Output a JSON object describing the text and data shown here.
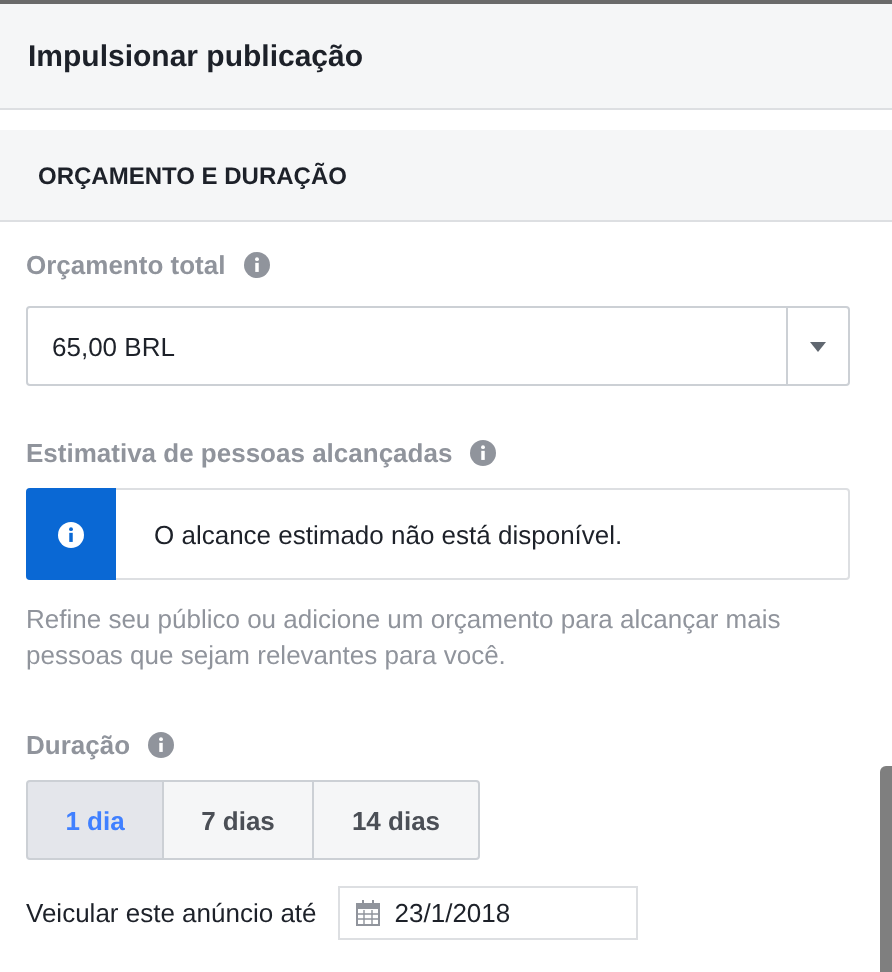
{
  "header": {
    "title": "Impulsionar publicação"
  },
  "section": {
    "title": "ORÇAMENTO E DURAÇÃO"
  },
  "budget": {
    "label": "Orçamento total",
    "value": "65,00 BRL"
  },
  "reach": {
    "label": "Estimativa de pessoas alcançadas",
    "notice": "O alcance estimado não está disponível.",
    "hint": "Refine seu público ou adicione um orçamento para alcançar mais pessoas que sejam relevantes para você."
  },
  "duration": {
    "label": "Duração",
    "options": [
      {
        "label": "1 dia",
        "selected": true
      },
      {
        "label": "7 dias",
        "selected": false
      },
      {
        "label": "14 dias",
        "selected": false
      }
    ]
  },
  "end_date": {
    "label": "Veicular este anúncio até",
    "value": "23/1/2018"
  }
}
